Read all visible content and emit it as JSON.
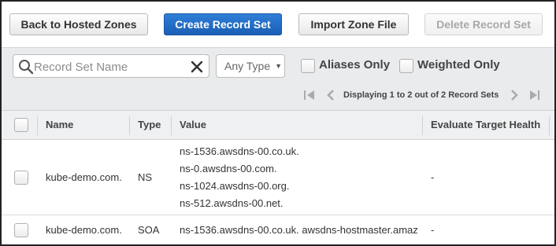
{
  "toolbar": {
    "back_label": "Back to Hosted Zones",
    "create_label": "Create Record Set",
    "import_label": "Import Zone File",
    "delete_label": "Delete Record Set"
  },
  "filters": {
    "search_placeholder": "Record Set Name",
    "search_value": "",
    "type_select": "Any Type",
    "aliases_label": "Aliases Only",
    "weighted_label": "Weighted Only",
    "pagination": "Displaying 1 to 2 out of 2 Record Sets"
  },
  "table": {
    "columns": [
      "Name",
      "Type",
      "Value",
      "Evaluate Target Health"
    ],
    "rows": [
      {
        "name": "kube-demo.com.",
        "type": "NS",
        "values": [
          "ns-1536.awsdns-00.co.uk.",
          "ns-0.awsdns-00.com.",
          "ns-1024.awsdns-00.org.",
          "ns-512.awsdns-00.net."
        ],
        "health": "-"
      },
      {
        "name": "kube-demo.com.",
        "type": "SOA",
        "values": [
          "ns-1536.awsdns-00.co.uk. awsdns-hostmaster.amaz"
        ],
        "health": "-"
      }
    ]
  },
  "colors": {
    "primary_button": "#2272c8",
    "filter_band": "#e9ebed",
    "header_band": "#eef0f2"
  }
}
